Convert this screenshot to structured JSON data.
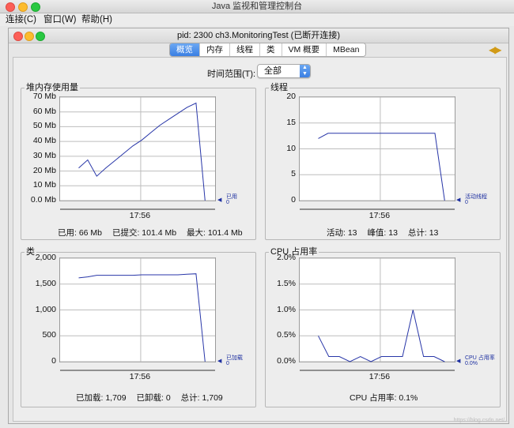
{
  "app": {
    "title": "Java 监视和管理控制台",
    "menus": [
      "连接(C)",
      "窗口(W)",
      "帮助(H)"
    ]
  },
  "window": {
    "title": "pid: 2300 ch3.MonitoringTest (已断开连接)",
    "tabs": [
      {
        "label": "概览",
        "active": true
      },
      {
        "label": "内存",
        "active": false
      },
      {
        "label": "线程",
        "active": false
      },
      {
        "label": "类",
        "active": false
      },
      {
        "label": "VM 概要",
        "active": false
      },
      {
        "label": "MBean",
        "active": false
      }
    ]
  },
  "timerange": {
    "label": "时间范围(T):",
    "value": "全部"
  },
  "panels": {
    "heap": {
      "title": "堆内存使用量",
      "legend": [
        "已用",
        "0"
      ],
      "stats": [
        "已用: 66 Mb",
        "已提交: 101.4 Mb",
        "最大: 101.4 Mb"
      ]
    },
    "threads": {
      "title": "线程",
      "legend": [
        "活动线程",
        "0"
      ],
      "stats": [
        "活动: 13",
        "峰值: 13",
        "总计: 13"
      ]
    },
    "classes": {
      "title": "类",
      "legend": [
        "已加载",
        "0"
      ],
      "stats": [
        "已加载: 1,709",
        "已卸载: 0",
        "总计: 1,709"
      ]
    },
    "cpu": {
      "title": "CPU 占用率",
      "legend": [
        "CPU 占用率",
        "0.0%"
      ],
      "stats": [
        "CPU 占用率: 0.1%"
      ]
    }
  },
  "chart_data": [
    {
      "type": "line",
      "title": "堆内存使用量",
      "ylim": [
        0,
        70
      ],
      "yticks": [
        "0.0 Mb",
        "10 Mb",
        "20 Mb",
        "30 Mb",
        "40 Mb",
        "50 Mb",
        "60 Mb",
        "70 Mb"
      ],
      "xticks": [
        "17:56"
      ],
      "series": [
        {
          "name": "已用",
          "values": [
            22,
            27.5,
            16.5,
            22,
            27,
            32,
            37,
            41,
            46,
            51,
            55,
            59,
            63,
            66,
            0
          ]
        }
      ]
    },
    {
      "type": "line",
      "title": "线程",
      "ylim": [
        0,
        20
      ],
      "yticks": [
        "0",
        "5",
        "10",
        "15",
        "20"
      ],
      "xticks": [
        "17:56"
      ],
      "series": [
        {
          "name": "活动线程",
          "values": [
            12,
            13,
            13,
            13,
            13,
            13,
            13,
            13,
            13,
            13,
            13,
            13,
            13,
            0
          ]
        }
      ]
    },
    {
      "type": "line",
      "title": "类",
      "ylim": [
        0,
        2000
      ],
      "yticks": [
        "0",
        "500",
        "1,000",
        "1,500",
        "2,000"
      ],
      "xticks": [
        "17:56"
      ],
      "series": [
        {
          "name": "已加载",
          "values": [
            1620,
            1640,
            1670,
            1670,
            1670,
            1670,
            1670,
            1680,
            1680,
            1680,
            1680,
            1680,
            1690,
            1700,
            0
          ]
        }
      ]
    },
    {
      "type": "line",
      "title": "CPU 占用率",
      "ylim": [
        0,
        2.0
      ],
      "yticks": [
        "0.0%",
        "0.5%",
        "1.0%",
        "1.5%",
        "2.0%"
      ],
      "xticks": [
        "17:56"
      ],
      "series": [
        {
          "name": "CPU 占用率",
          "values": [
            0.5,
            0.1,
            0.1,
            0.0,
            0.1,
            0.0,
            0.1,
            0.1,
            0.1,
            1.0,
            0.1,
            0.1,
            0.0
          ]
        }
      ]
    }
  ],
  "colors": {
    "series": "#2836a8",
    "grid": "#bdbdbd",
    "tab_active": "#3a7fe3"
  }
}
